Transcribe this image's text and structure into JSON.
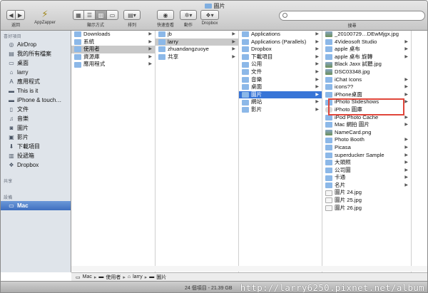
{
  "window": {
    "title": "圖片"
  },
  "toolbar": {
    "back_label": "返回",
    "appzapper_label": "AppZapper",
    "view_label": "顯示方式",
    "arrange_label": "排列",
    "quicklook_label": "快速查看",
    "action_label": "動作",
    "dropbox_label": "Dropbox",
    "search_label": "搜尋",
    "search_value": ""
  },
  "sidebar": {
    "devices_header": "喜好項目",
    "items": [
      {
        "label": "AirDrop",
        "icon": "airdrop-icon"
      },
      {
        "label": "我的所有檔案",
        "icon": "all-files-icon"
      },
      {
        "label": "桌面",
        "icon": "desktop-icon"
      },
      {
        "label": "larry",
        "icon": "home-icon"
      },
      {
        "label": "應用程式",
        "icon": "applications-icon"
      },
      {
        "label": "This is it",
        "icon": "folder-icon"
      },
      {
        "label": "iPhone & touch…",
        "icon": "folder-icon"
      },
      {
        "label": "文件",
        "icon": "documents-icon"
      },
      {
        "label": "音樂",
        "icon": "music-icon"
      },
      {
        "label": "圖片",
        "icon": "pictures-icon"
      },
      {
        "label": "影片",
        "icon": "movies-icon"
      },
      {
        "label": "下載項目",
        "icon": "downloads-icon"
      },
      {
        "label": "投遞箱",
        "icon": "dropbox-box-icon"
      },
      {
        "label": "Dropbox",
        "icon": "dropbox-icon"
      }
    ],
    "shared_header": "共享",
    "devices2_header": "設備",
    "device": "Mac"
  },
  "col1": [
    {
      "label": "Downloads"
    },
    {
      "label": "系統"
    },
    {
      "label": "使用者"
    },
    {
      "label": "資源庫"
    },
    {
      "label": "應用程式"
    }
  ],
  "col2": [
    {
      "label": "jb"
    },
    {
      "label": "larry"
    },
    {
      "label": "zhuandangzuoye"
    },
    {
      "label": "共享"
    }
  ],
  "col3": [
    {
      "label": "Applications"
    },
    {
      "label": "Applications (Parallels)"
    },
    {
      "label": "Dropbox"
    },
    {
      "label": "下載項目"
    },
    {
      "label": "公用"
    },
    {
      "label": "文件"
    },
    {
      "label": "音樂"
    },
    {
      "label": "桌面"
    },
    {
      "label": "圖片"
    },
    {
      "label": "網站"
    },
    {
      "label": "影片"
    }
  ],
  "col4": [
    {
      "label": "_20100729…DEwMjgx.jpg"
    },
    {
      "label": "4Videosoft Studio"
    },
    {
      "label": "apple 桌布"
    },
    {
      "label": "apple 桌布 旋轉"
    },
    {
      "label": "Black Jaxx 試聽.jpg"
    },
    {
      "label": "DSC03348.jpg"
    },
    {
      "label": "iChat Icons"
    },
    {
      "label": "icons??"
    },
    {
      "label": "iPhone桌面"
    },
    {
      "label": "iPhoto Slideshows"
    },
    {
      "label": "iPhoto 圖庫"
    },
    {
      "label": "iPod Photo Cache"
    },
    {
      "label": "Mac 網拍 圖片"
    },
    {
      "label": "NameCard.png"
    },
    {
      "label": "Photo Booth"
    },
    {
      "label": "Picasa"
    },
    {
      "label": "superducker Sample"
    },
    {
      "label": "大頭照"
    },
    {
      "label": "公司圖"
    },
    {
      "label": "卡通"
    },
    {
      "label": "名片"
    },
    {
      "label": "圖片 24.jpg"
    },
    {
      "label": "圖片 25.jpg"
    },
    {
      "label": "圖片 26.jpg"
    }
  ],
  "pathbar": [
    "Mac",
    "使用者",
    "larry",
    "圖片"
  ],
  "status": {
    "text": "24 個項目 - 21.39 GB",
    "watermark": "http://larry6250.pixnet.net/album"
  }
}
